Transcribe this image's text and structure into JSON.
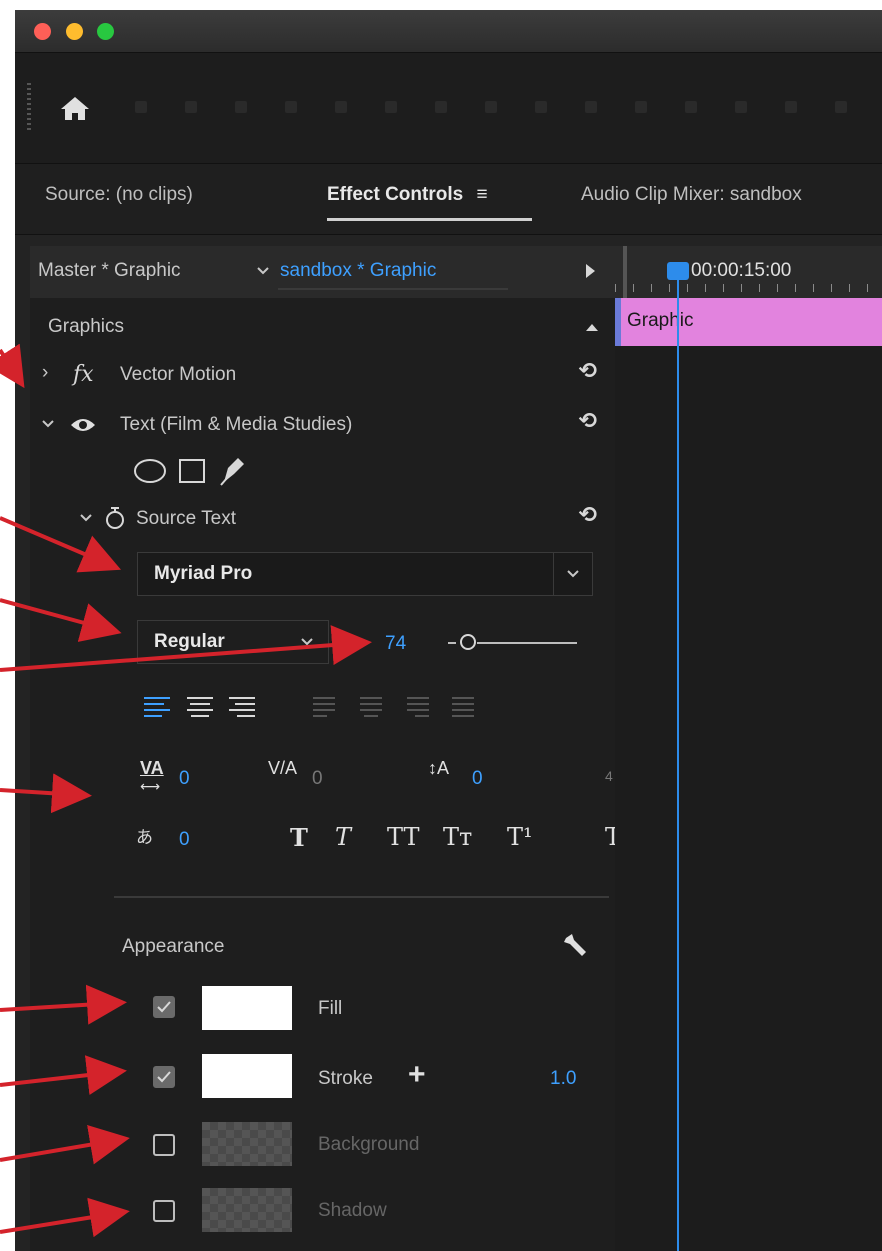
{
  "tabs": {
    "source": "Source: (no clips)",
    "effect_controls": "Effect Controls",
    "audio_mixer": "Audio Clip Mixer: sandbox"
  },
  "panel": {
    "master_label": "Master * Graphic",
    "sequence_label": "sandbox * Graphic",
    "section": "Graphics",
    "vector_motion": "Vector Motion",
    "text_layer": "Text (Film & Media Studies)",
    "source_text": "Source Text",
    "font_family": "Myriad Pro",
    "font_style": "Regular",
    "font_size": "74",
    "tracking": "0",
    "kerning": "0",
    "leading": "0",
    "tsume": "0",
    "appearance": "Appearance",
    "fill_label": "Fill",
    "stroke_label": "Stroke",
    "stroke_width": "1.0",
    "background_label": "Background",
    "shadow_label": "Shadow",
    "fill_checked": true,
    "stroke_checked": true,
    "background_checked": false,
    "shadow_checked": false
  },
  "timeline": {
    "timecode": "00:00:15:00",
    "clip_label": "Graphic"
  },
  "colors": {
    "accent_blue": "#2d8ceb",
    "clip_pink": "#e283de",
    "arrow_red": "#d4232b"
  }
}
